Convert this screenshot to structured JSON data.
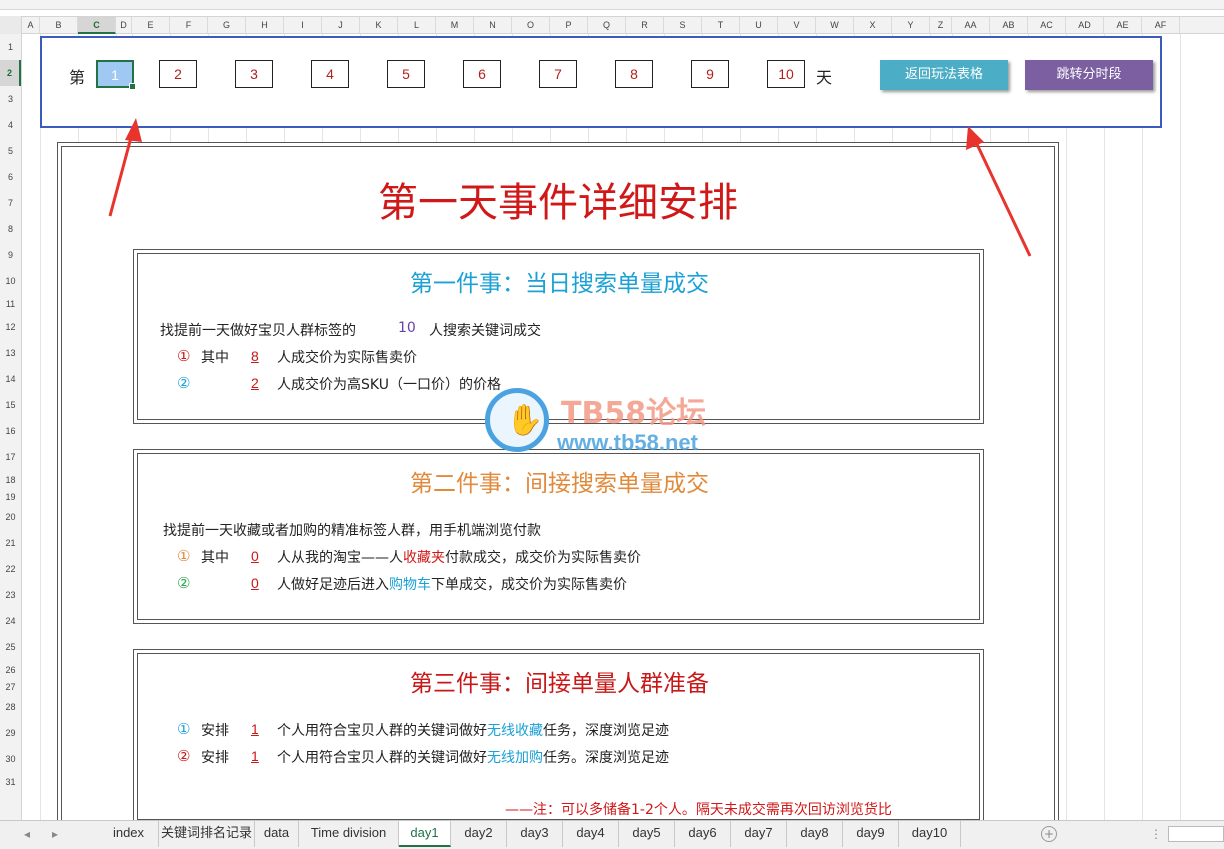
{
  "sheet": {
    "columns": [
      "A",
      "B",
      "C",
      "D",
      "E",
      "F",
      "G",
      "H",
      "I",
      "J",
      "K",
      "L",
      "M",
      "N",
      "O",
      "P",
      "Q",
      "R",
      "S",
      "T",
      "U",
      "V",
      "W",
      "X",
      "Y",
      "Z",
      "AA",
      "AB",
      "AC",
      "AD",
      "AE",
      "AF"
    ],
    "rows": [
      "1",
      "2",
      "3",
      "4",
      "5",
      "6",
      "7",
      "8",
      "9",
      "10",
      "11",
      "12",
      "13",
      "14",
      "15",
      "16",
      "17",
      "18",
      "19",
      "20",
      "21",
      "22",
      "23",
      "24",
      "25",
      "26",
      "27",
      "28",
      "29",
      "30",
      "31"
    ],
    "selected_column": "C",
    "selected_row": "2"
  },
  "nav": {
    "prefix": "第",
    "suffix": "天",
    "days": [
      "1",
      "2",
      "3",
      "4",
      "5",
      "6",
      "7",
      "8",
      "9",
      "10"
    ],
    "active_day": "1",
    "back_button": "返回玩法表格",
    "jump_button": "跳转分时段"
  },
  "doc": {
    "title": "第一天事件详细安排",
    "section1": {
      "title": "第一件事：当日搜索单量成交",
      "line1_pre": "找提前一天做好宝贝人群标签的",
      "line1_num": "10",
      "line1_post": "人搜索关键词成交",
      "item1_mark": "①",
      "item1_pre": "其中",
      "item1_num": "8",
      "item1_text": "人成交价为实际售卖价",
      "item2_mark": "②",
      "item2_num": "2",
      "item2_text": "人成交价为高SKU（一口价）的价格"
    },
    "section2": {
      "title": "第二件事：间接搜索单量成交",
      "line1": "找提前一天收藏或者加购的精准标签人群，用手机端浏览付款",
      "item1_mark": "①",
      "item1_pre": "其中",
      "item1_num": "0",
      "item1_text_a": "人从我的淘宝——人",
      "item1_highlight": "收藏夹",
      "item1_text_b": "付款成交，成交价为实际售卖价",
      "item2_mark": "②",
      "item2_num": "0",
      "item2_text_a": "人做好足迹后进入",
      "item2_highlight": "购物车",
      "item2_text_b": "下单成交，成交价为实际售卖价"
    },
    "section3": {
      "title": "第三件事：间接单量人群准备",
      "item1_mark": "①",
      "item1_pre": "安排",
      "item1_num": "1",
      "item1_text_a": "个人用符合宝贝人群的关键词做好",
      "item1_highlight": "无线收藏",
      "item1_text_b": "任务，深度浏览足迹",
      "item2_mark": "②",
      "item2_pre": "安排",
      "item2_num": "1",
      "item2_text_a": "个人用符合宝贝人群的关键词做好",
      "item2_highlight": "无线加购",
      "item2_text_b": "任务。深度浏览足迹"
    },
    "note": "——注：可以多储备1-2个人。隔天未成交需再次回访浏览货比"
  },
  "watermark": {
    "title": "TB58论坛",
    "url": "www.tb58.net"
  },
  "tabs": {
    "items": [
      "index",
      "关键词排名记录",
      "data",
      "Time division",
      "day1",
      "day2",
      "day3",
      "day4",
      "day5",
      "day6",
      "day7",
      "day8",
      "day9",
      "day10"
    ],
    "active": "day1",
    "prev": "◂",
    "next": "▸",
    "add": "+",
    "more": "⋮"
  },
  "colors": {
    "title_red": "#d01818",
    "sec1_blue": "#1ba1d6",
    "sec2_orange": "#e08a3c",
    "sec3_red": "#c81818",
    "excel_green": "#217346",
    "nav_border": "#3b5bbd",
    "btn_teal": "#4badc6",
    "btn_purple": "#7b5fa0"
  }
}
